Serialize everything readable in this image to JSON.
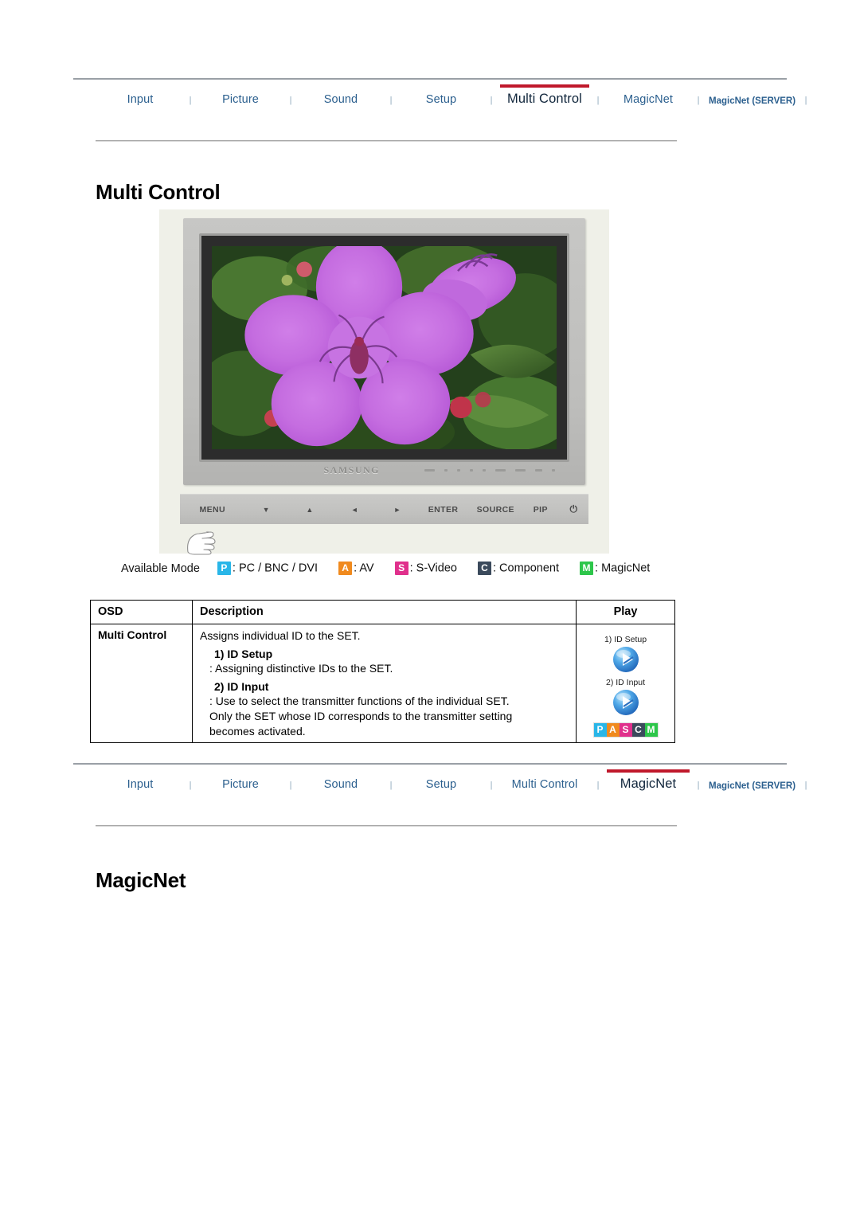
{
  "nav": {
    "separator": "|",
    "items_top": [
      {
        "label": "Input",
        "active": false,
        "style": "normal"
      },
      {
        "label": "Picture",
        "active": false,
        "style": "normal"
      },
      {
        "label": "Sound",
        "active": false,
        "style": "normal"
      },
      {
        "label": "Setup",
        "active": false,
        "style": "normal"
      },
      {
        "label": "Multi Control",
        "active": true,
        "style": "normal"
      },
      {
        "label": "MagicNet",
        "active": false,
        "style": "normal"
      },
      {
        "label": "MagicNet (SERVER)",
        "active": false,
        "style": "small"
      }
    ],
    "items_bottom": [
      {
        "label": "Input",
        "active": false,
        "style": "normal"
      },
      {
        "label": "Picture",
        "active": false,
        "style": "normal"
      },
      {
        "label": "Sound",
        "active": false,
        "style": "normal"
      },
      {
        "label": "Setup",
        "active": false,
        "style": "normal"
      },
      {
        "label": "Multi Control",
        "active": false,
        "style": "normal"
      },
      {
        "label": "MagicNet",
        "active": true,
        "style": "normal"
      },
      {
        "label": "MagicNet (SERVER)",
        "active": false,
        "style": "small"
      }
    ],
    "accent_color": "#c0182b",
    "link_color": "#2b5f8e",
    "active_color": "#10253b"
  },
  "sections": {
    "multi_control_title": "Multi Control",
    "magicnet_title": "MagicNet"
  },
  "monitor": {
    "brand": "SAMSUNG",
    "buttons": [
      "MENU",
      "▼",
      "▲",
      "◄",
      "►",
      "ENTER",
      "SOURCE",
      "PIP",
      "⏻"
    ],
    "background_color": "#eff0e8"
  },
  "available_mode": {
    "label": "Available Mode",
    "modes": [
      {
        "code": "P",
        "text": ": PC / BNC / DVI",
        "color": "#29b6e8"
      },
      {
        "code": "A",
        "text": ": AV",
        "color": "#f08a1e"
      },
      {
        "code": "S",
        "text": ": S-Video",
        "color": "#e0308c"
      },
      {
        "code": "C",
        "text": ": Component",
        "color": "#3b4a5c"
      },
      {
        "code": "M",
        "text": ": MagicNet",
        "color": "#2dc64a"
      }
    ]
  },
  "table": {
    "headers": [
      "OSD",
      "Description",
      "Play"
    ],
    "rows": [
      {
        "osd": "Multi Control",
        "description": {
          "intro": "Assigns individual ID to the SET.",
          "item1_title": "1) ID Setup",
          "item1_body": ": Assigning distinctive IDs to the SET.",
          "item2_title": "2) ID Input",
          "item2_body_line1": ": Use to select the transmitter functions of the individual SET.",
          "item2_body_line2": "Only the SET whose ID corresponds to the transmitter setting",
          "item2_body_line3": "becomes activated."
        },
        "play": {
          "label1": "1) ID Setup",
          "label2": "2) ID Input",
          "badges": [
            {
              "code": "P",
              "color": "#29b6e8"
            },
            {
              "code": "A",
              "color": "#f08a1e"
            },
            {
              "code": "S",
              "color": "#e0308c"
            },
            {
              "code": "C",
              "color": "#3b4a5c"
            },
            {
              "code": "M",
              "color": "#2dc64a"
            }
          ]
        }
      }
    ]
  }
}
